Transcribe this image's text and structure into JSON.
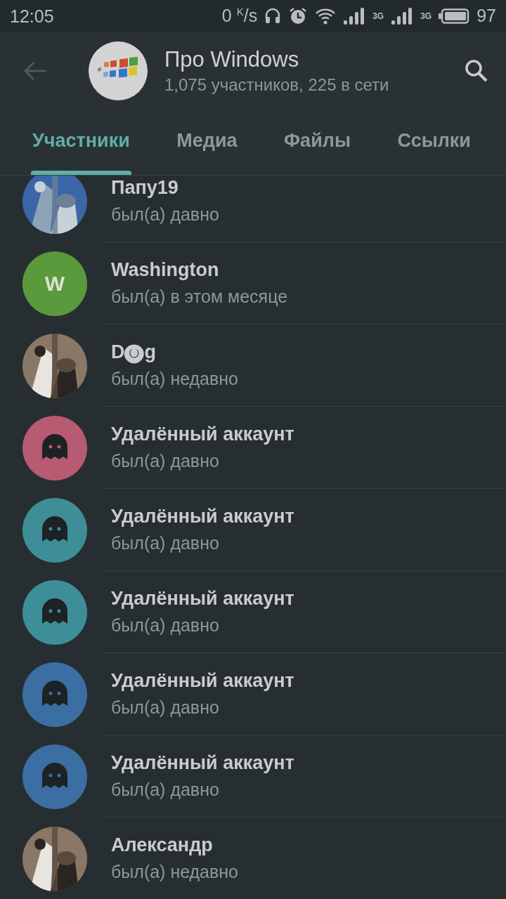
{
  "status_bar": {
    "time": "12:05",
    "speed": "0 $^{K}$/s",
    "network_1": "3G",
    "network_2": "3G",
    "battery": "97"
  },
  "header": {
    "title": "Про Windows",
    "subtitle": "1,075 участников, 225 в сети"
  },
  "tabs": [
    {
      "label": "Участники",
      "selected": true
    },
    {
      "label": "Медиа",
      "selected": false
    },
    {
      "label": "Файлы",
      "selected": false
    },
    {
      "label": "Ссылки",
      "selected": false
    }
  ],
  "members": [
    {
      "name": "Папу19",
      "status": "был(а) давно"
    },
    {
      "name": "Washington",
      "status": "был(а) в этом месяце",
      "avatar": {
        "kind": "letter",
        "letter": "W",
        "color": "#5a9a3c"
      }
    },
    {
      "name": "D🅞g",
      "status": "был(а) недавно"
    },
    {
      "name": "Удалённый аккаунт",
      "status": "был(а) давно",
      "avatar": {
        "kind": "ghost",
        "color": "#b85a72"
      }
    },
    {
      "name": "Удалённый аккаунт",
      "status": "был(а) давно",
      "avatar": {
        "kind": "ghost",
        "color": "#3e8e98"
      }
    },
    {
      "name": "Удалённый аккаунт",
      "status": "был(а) давно",
      "avatar": {
        "kind": "ghost",
        "color": "#3e8e98"
      }
    },
    {
      "name": "Удалённый аккаунт",
      "status": "был(а) давно",
      "avatar": {
        "kind": "ghost",
        "color": "#3b6fa3"
      }
    },
    {
      "name": "Удалённый аккаунт",
      "status": "был(а) давно",
      "avatar": {
        "kind": "ghost",
        "color": "#3b6fa3"
      }
    },
    {
      "name": "Александр",
      "status": "был(а) недавно"
    }
  ]
}
